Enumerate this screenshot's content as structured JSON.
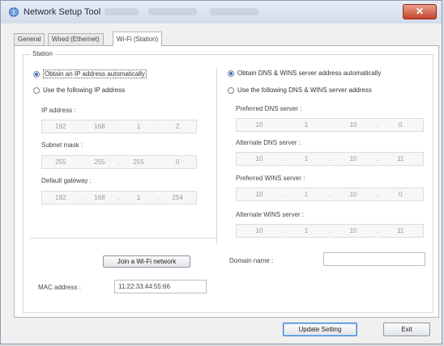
{
  "window": {
    "title": "Network Setup Tool",
    "close_label": "✕"
  },
  "tabs": [
    {
      "label": "General"
    },
    {
      "label": "Wired (Ethernet)"
    },
    {
      "label": "Wi-Fi (Station)"
    }
  ],
  "station_group": {
    "label": "Station"
  },
  "ip": {
    "auto_label": "Obtain an IP address automatically",
    "manual_label": "Use the following IP address",
    "selected": "auto",
    "ip_address": {
      "label": "IP address :",
      "octets": [
        "192",
        "168",
        "1",
        "2"
      ]
    },
    "subnet_mask": {
      "label": "Subnet mask :",
      "octets": [
        "255",
        "255",
        "255",
        "0"
      ]
    },
    "default_gateway": {
      "label": "Default gateway :",
      "octets": [
        "192",
        "168",
        "1",
        "254"
      ]
    }
  },
  "dns": {
    "auto_label": "Obtain DNS & WINS server address automatically",
    "manual_label": "Use the following DNS & WINS server address",
    "selected": "auto",
    "preferred_dns": {
      "label": "Preferred DNS server :",
      "octets": [
        "10",
        "1",
        "10",
        "0"
      ]
    },
    "alternate_dns": {
      "label": "Alternate DNS server :",
      "octets": [
        "10",
        "1",
        "10",
        "11"
      ]
    },
    "preferred_wins": {
      "label": "Preferred WINS server :",
      "octets": [
        "10",
        "1",
        "10",
        "0"
      ]
    },
    "alternate_wins": {
      "label": "Alternate WINS server :",
      "octets": [
        "10",
        "1",
        "10",
        "11"
      ]
    }
  },
  "join_button": {
    "label": "Join a Wi-Fi network"
  },
  "domain": {
    "label": "Domain name :",
    "value": ""
  },
  "mac": {
    "label": "MAC address :",
    "value": "11:22:33:44:55:66"
  },
  "footer": {
    "update_label": "Update Setting",
    "exit_label": "Exit"
  },
  "colors": {
    "accent": "#2f6fd0",
    "close": "#c6452c"
  }
}
